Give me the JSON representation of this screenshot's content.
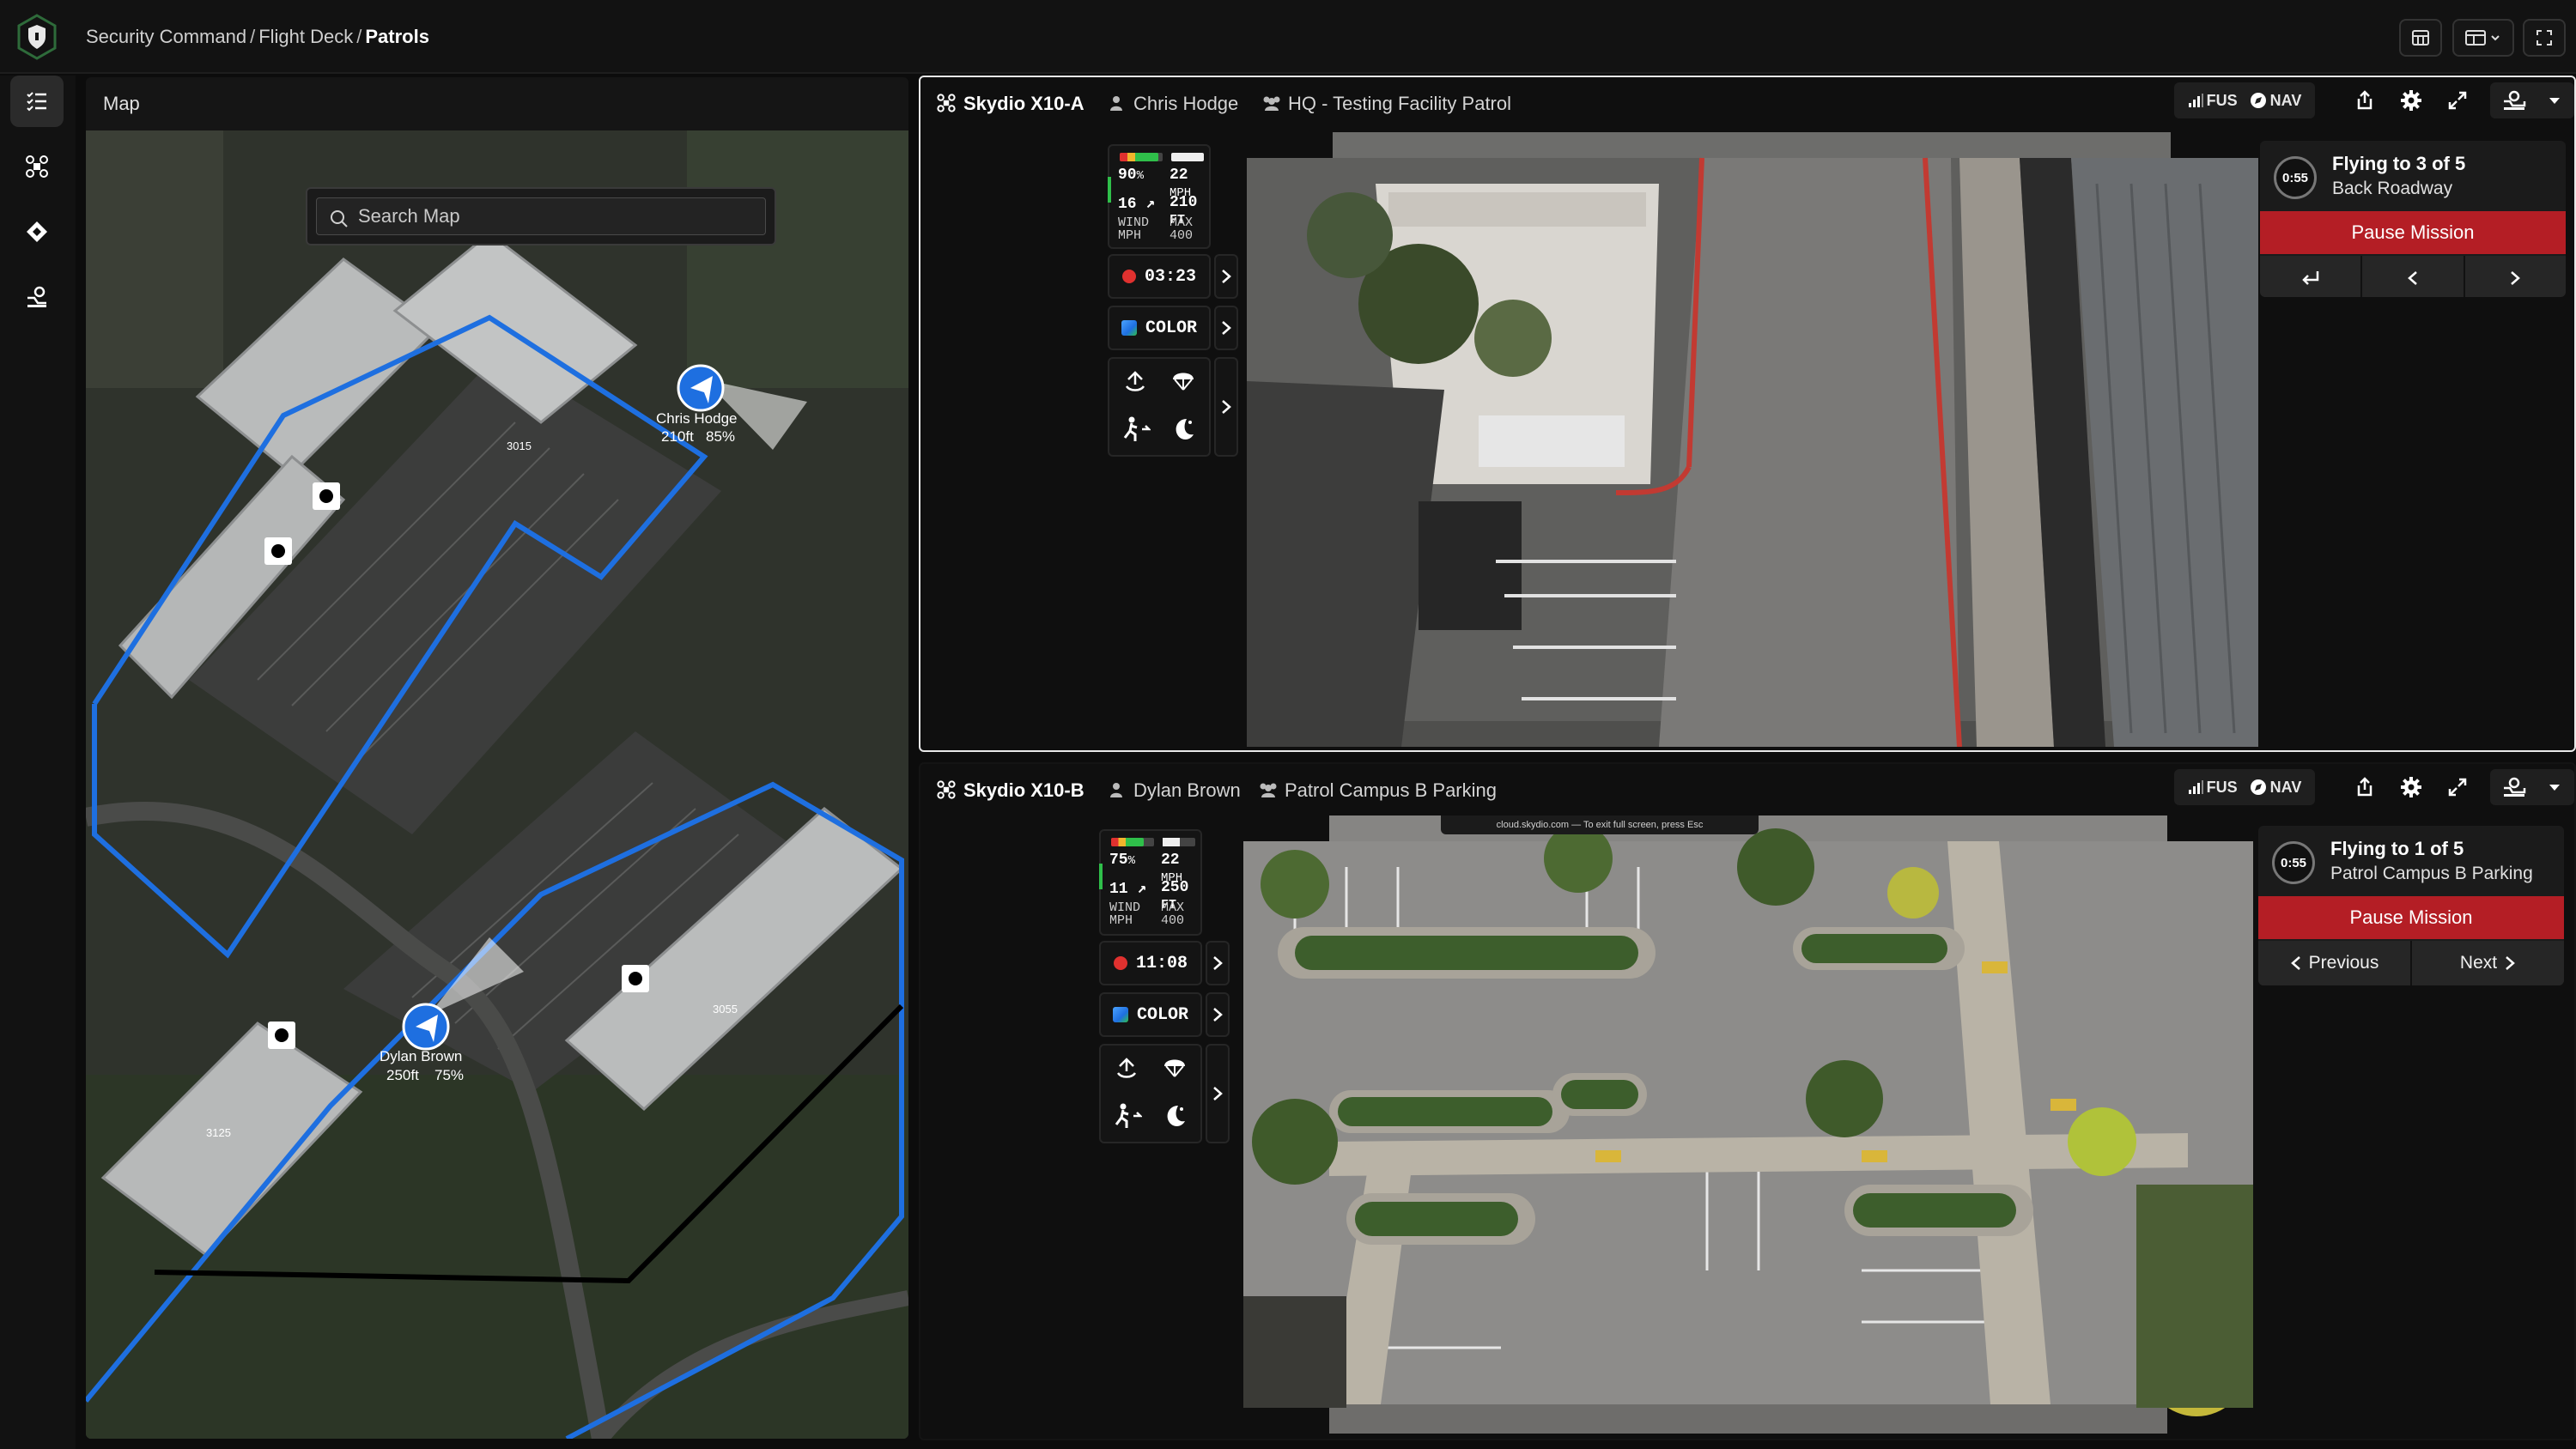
{
  "breadcrumb": {
    "items": [
      "Security Command",
      "Flight Deck"
    ],
    "current": "Patrols"
  },
  "icons": {
    "logo": "shield-logo-icon",
    "rail": [
      "patrol-list-icon",
      "drone-icon",
      "waypoint-icon",
      "dock-icon"
    ],
    "topbar": [
      "layout-grid-icon",
      "split-view-icon",
      "fullscreen-icon"
    ]
  },
  "map": {
    "title": "Map",
    "search_placeholder": "Search Map",
    "markers": [
      {
        "name": "Chris Hodge",
        "altitude": "210ft",
        "battery": "85%"
      },
      {
        "name": "Dylan Brown",
        "altitude": "250ft",
        "battery": "75%"
      }
    ],
    "building_labels": [
      "3015",
      "3055",
      "3125"
    ]
  },
  "drones": [
    {
      "name": "Skydio X10-A",
      "pilot": "Chris Hodge",
      "mission": "HQ - Testing Facility Patrol",
      "fus_label": "FUS",
      "nav_label": "NAV",
      "telemetry": {
        "battery": "90",
        "battery_unit": "%",
        "speed": "22",
        "speed_unit": "MPH",
        "wind": "16",
        "altitude": "210",
        "altitude_unit": "FT",
        "wind_label_1": "WIND",
        "wind_label_2": "MPH",
        "max_label": "MAX",
        "max_value": "400",
        "timer": "03:23",
        "color_mode": "COLOR"
      },
      "status": {
        "timer": "0:55",
        "line1": "Flying to 3 of 5",
        "line2": "Back Roadway",
        "pause_label": "Pause Mission"
      },
      "nav_buttons": [
        "",
        "",
        ""
      ],
      "colors": {
        "battery_fill": "#2fbf4a",
        "battery_level": 0.9
      }
    },
    {
      "name": "Skydio X10-B",
      "pilot": "Dylan Brown",
      "mission": "Patrol Campus B Parking",
      "fus_label": "FUS",
      "nav_label": "NAV",
      "telemetry": {
        "battery": "75",
        "battery_unit": "%",
        "speed": "22",
        "speed_unit": "MPH",
        "wind": "11",
        "altitude": "250",
        "altitude_unit": "FT",
        "wind_label_1": "WIND",
        "wind_label_2": "MPH",
        "max_label": "MAX",
        "max_value": "400",
        "timer": "11:08",
        "color_mode": "COLOR"
      },
      "status": {
        "timer": "0:55",
        "line1": "Flying to 1 of 5",
        "line2": "Patrol Campus B Parking",
        "pause_label": "Pause Mission"
      },
      "nav_buttons": [
        "Previous",
        "Next"
      ],
      "video_banner": "cloud.skydio.com — To exit full screen, press Esc",
      "colors": {
        "battery_fill": "#2fbf4a",
        "battery_level": 0.75
      }
    }
  ],
  "colors": {
    "accent_blue": "#1e6fe0",
    "alert_red": "#b41e25",
    "record_red": "#e0312f",
    "panel_bg": "#151515"
  }
}
